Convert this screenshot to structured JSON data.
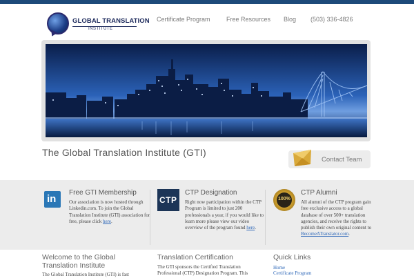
{
  "brand": {
    "logo_line1": "GLOBAL TRANSLATION",
    "logo_line2": "INSTITUTE"
  },
  "nav": {
    "items": [
      "Certificate Program",
      "Free Resources",
      "Blog",
      "(503) 336-4826"
    ]
  },
  "intro": {
    "title": "The Global Translation Institute (GTI)",
    "contact_label": "Contact Team"
  },
  "features": [
    {
      "title": "Free GTI Membership",
      "body": "Our association is now hosted through Linkedin.com. To join the Global Translation Institute (GTI) association for free, please click ",
      "link": "here",
      "tail": ".",
      "icon_text": "in"
    },
    {
      "title": "CTP Designation",
      "body": "Right now participation within the CTP Program is limited to just 200 professionals a year, if you would like to learn more please view our video overview of the program found ",
      "link": "here",
      "tail": ".",
      "icon_text": "CTP"
    },
    {
      "title": "CTP Alumni",
      "body": "All alumni of the CTP program gain free exclusive access to a global database of over 500+ translation agencies, and receive the rights to publish their own original content to ",
      "link": "BecomeATranslator.com",
      "tail": ".",
      "icon_text": "100%"
    }
  ],
  "bottom": {
    "welcome_title": "Welcome to the Global Translation Institute",
    "welcome_body": "The Global Translation Institute (GTI) is fast",
    "cert_title": "Translation Certification",
    "cert_body": "The GTI sponsors the Certified Translation Professional (CTP) Designation Program. This",
    "quick_title": "Quick Links",
    "quick_links": [
      "Home",
      "Certificate Program"
    ]
  },
  "colors": {
    "top_bar": "#1d4a7a",
    "link": "#2d67b8",
    "band": "#ececec"
  }
}
